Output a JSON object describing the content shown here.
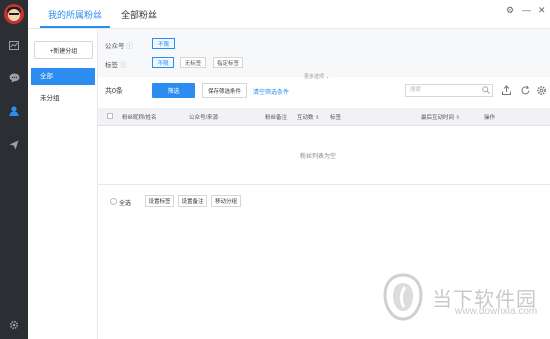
{
  "tabs": {
    "mine": "我的所属粉丝",
    "all": "全部粉丝"
  },
  "window": {
    "settings": "⚙",
    "minimize": "—",
    "close": "✕"
  },
  "sidebar": {
    "new_group": "+新建分组",
    "groups": [
      "全部",
      "未分组"
    ]
  },
  "filters": {
    "account_label": "公众号",
    "tag_label": "标签",
    "account_options": [
      "不限"
    ],
    "tag_options": [
      "不限",
      "无标签",
      "指定标签"
    ],
    "more": "更多选项"
  },
  "toolbar": {
    "count": "共0条",
    "filter_btn": "筛选",
    "save_btn": "保存筛选条件",
    "clear_link": "清空筛选条件",
    "search_placeholder": "搜索"
  },
  "table": {
    "columns": [
      "粉丝昵称/姓名",
      "公众号/来源",
      "粉丝备注",
      "互动数",
      "标签",
      "最后互动时间",
      "操作"
    ],
    "empty": "粉丝列表为空"
  },
  "bottom": {
    "select_all": "全选",
    "buttons": [
      "设置标签",
      "设置备注",
      "移动分组"
    ]
  },
  "watermark": {
    "title": "当下软件园",
    "url": "www.downxia.com"
  },
  "colors": {
    "accent": "#2d8cf0",
    "rail": "#2b2f33"
  }
}
